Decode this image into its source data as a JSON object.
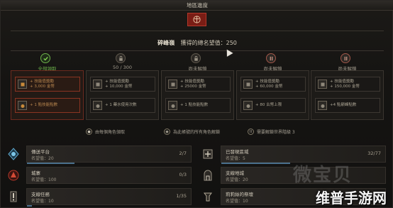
{
  "window": {
    "title": "地區進度"
  },
  "colors": {
    "accent_red": "#c13a2a",
    "complete_green": "#6db24a",
    "gold_text": "#b8864e",
    "progress_blue": "#4a6f8c"
  },
  "header": {
    "region": "碎峰嶺",
    "renown_label": "獲得的總名望值：250"
  },
  "tiers": [
    {
      "status": "全部領取",
      "state": "claimed",
      "icon": "check-icon",
      "rewards": [
        {
          "icon": "skill-point-icon",
          "text": "+ 技能值獎勵\n+ 3,000 金幣"
        },
        {
          "icon": "potion-icon",
          "text": "+ 1 點技能點數"
        }
      ]
    },
    {
      "status": "50 / 300",
      "state": "in-progress",
      "progress": 0.17,
      "icon": "lock-icon",
      "rewards": [
        {
          "icon": "skill-point-icon",
          "text": "+ 技能值獎勵\n+ 10,000 金幣"
        },
        {
          "icon": "potion-icon",
          "text": "+ 1 藥水使用次數"
        }
      ]
    },
    {
      "status": "尚未解鎖",
      "state": "locked",
      "icon": "lock-icon",
      "rewards": [
        {
          "icon": "skill-point-icon",
          "text": "+ 技能值獎勵\n+ 25000 金幣"
        },
        {
          "icon": "potion-icon",
          "text": "+ 1 點技能點數"
        }
      ]
    },
    {
      "status": "尚未解鎖",
      "state": "locked-expansion",
      "icon": "roman-two-icon",
      "rewards": [
        {
          "icon": "skill-point-icon",
          "text": "+ 技能值獎勵\n+ 60,000 金幣"
        },
        {
          "icon": "potion-icon",
          "text": "+ 80 古幣上限"
        }
      ]
    },
    {
      "status": "尚未解鎖",
      "state": "locked-expansion",
      "icon": "roman-two-icon",
      "rewards": [
        {
          "icon": "skill-point-icon",
          "text": "+ 技能值獎勵\n+ 150,000 金幣"
        },
        {
          "icon": "potion-icon",
          "text": "+4 點巔峰點數"
        }
      ]
    }
  ],
  "notes": [
    {
      "icon": "character-icon",
      "text": "由每個角色領取"
    },
    {
      "icon": "account-icon",
      "text": "為此帳號的所有角色解鎖"
    },
    {
      "icon": "roman-two-icon",
      "text": "需要解鎖世界階級 3"
    }
  ],
  "activities": {
    "left": [
      {
        "icon": "waypoint-icon",
        "title": "傳送平台",
        "sub": "名望值：20",
        "count": "2/7",
        "progress": 0.29
      },
      {
        "icon": "dungeon-icon",
        "title": "城寨",
        "sub": "名望值：100",
        "count": "0/3",
        "progress": 0
      },
      {
        "icon": "quest-icon",
        "title": "支線任務",
        "sub": "名望值：10",
        "count": "1/35",
        "progress": 0.03
      }
    ],
    "right": [
      {
        "icon": "area-icon",
        "title": "已發現區域",
        "sub": "名望值：5",
        "count": "32/77",
        "progress": 0.42
      },
      {
        "icon": "stronghold-icon",
        "title": "支線地城",
        "sub": "名望值：20",
        "count": "",
        "progress": 0
      },
      {
        "icon": "altar-icon",
        "title": "莉莉絲的祭壇",
        "sub": "名望值：10",
        "count": "",
        "progress": 0
      }
    ]
  },
  "watermark": {
    "text": "微宝贝",
    "logo": "维普手游网"
  }
}
